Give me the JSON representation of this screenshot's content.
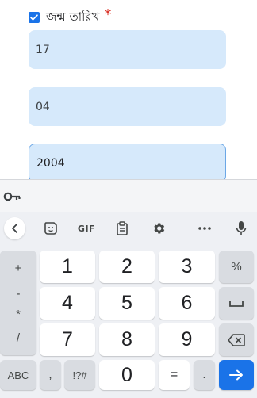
{
  "form": {
    "checkbox_checked": true,
    "label": "জন্ম তারিখ",
    "required_mark": "*",
    "fields": [
      {
        "name": "day",
        "value": "17"
      },
      {
        "name": "month",
        "value": "04"
      },
      {
        "name": "year",
        "value": "2004",
        "focused": true
      }
    ]
  },
  "keyboard": {
    "toolbar": {
      "gif_label": "GIF"
    },
    "digits": [
      "1",
      "2",
      "3",
      "4",
      "5",
      "6",
      "7",
      "8",
      "9",
      "0"
    ],
    "symbols_column": [
      "+",
      "-",
      "*",
      "/"
    ],
    "percent": "%",
    "bottom_row": {
      "abc_label": "ABC",
      "comma": ",",
      "symbols_label": "!?#",
      "equals": "=",
      "period": "."
    },
    "colors": {
      "accent": "#1a73e8",
      "field_bg": "#d6e9fb",
      "keyboard_bg": "#eef0f4",
      "side_key_bg": "#d9dce1"
    }
  }
}
